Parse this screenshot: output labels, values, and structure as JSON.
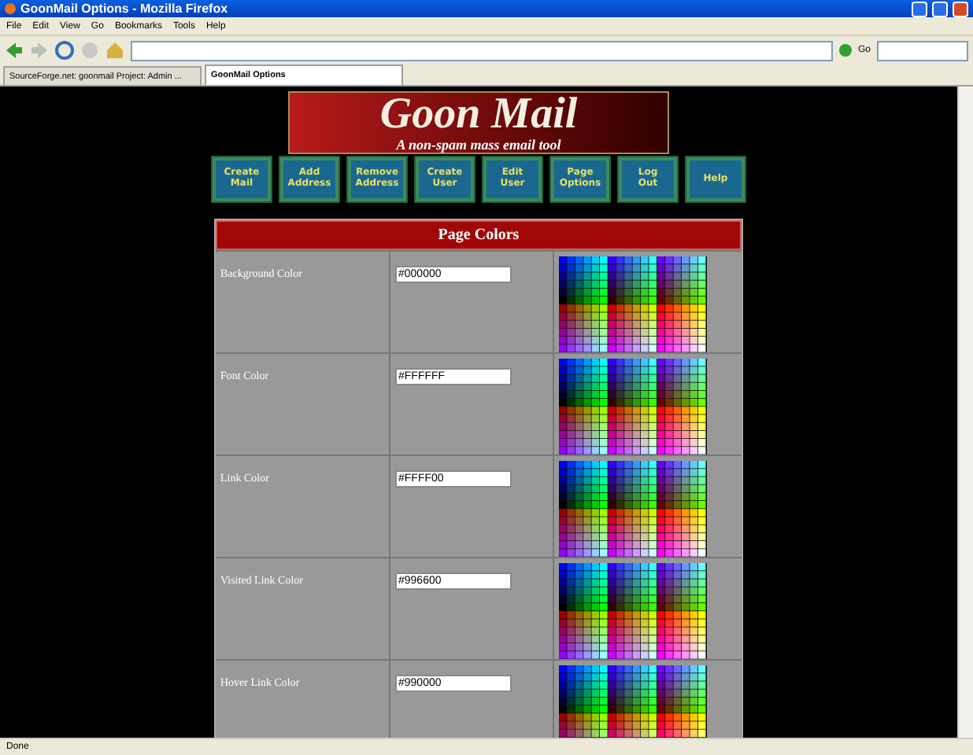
{
  "window": {
    "title": "GoonMail Options - Mozilla Firefox"
  },
  "menu": [
    "File",
    "Edit",
    "View",
    "Go",
    "Bookmarks",
    "Tools",
    "Help"
  ],
  "toolbar": {
    "go_label": "Go"
  },
  "tabs": [
    {
      "label": "SourceForge.net: goonmail Project: Admin ...",
      "selected": false
    },
    {
      "label": "GoonMail Options",
      "selected": true
    }
  ],
  "header": {
    "title": "Goon Mail",
    "subtitle": "A non-spam mass email tool"
  },
  "nav_buttons": [
    [
      "Create",
      "Mail"
    ],
    [
      "Add",
      "Address"
    ],
    [
      "Remove",
      "Address"
    ],
    [
      "Create",
      "User"
    ],
    [
      "Edit",
      "User"
    ],
    [
      "Page",
      "Options"
    ],
    [
      "Log",
      "Out"
    ],
    [
      "Help"
    ]
  ],
  "section": {
    "title": "Page Colors",
    "rows": [
      {
        "label": "Background Color",
        "value": "#000000"
      },
      {
        "label": "Font Color",
        "value": "#FFFFFF"
      },
      {
        "label": "Link Color",
        "value": "#FFFF00"
      },
      {
        "label": "Visited Link Color",
        "value": "#996600"
      },
      {
        "label": "Hover Link Color",
        "value": "#990000"
      }
    ]
  },
  "status_bar": {
    "text": "Done"
  }
}
